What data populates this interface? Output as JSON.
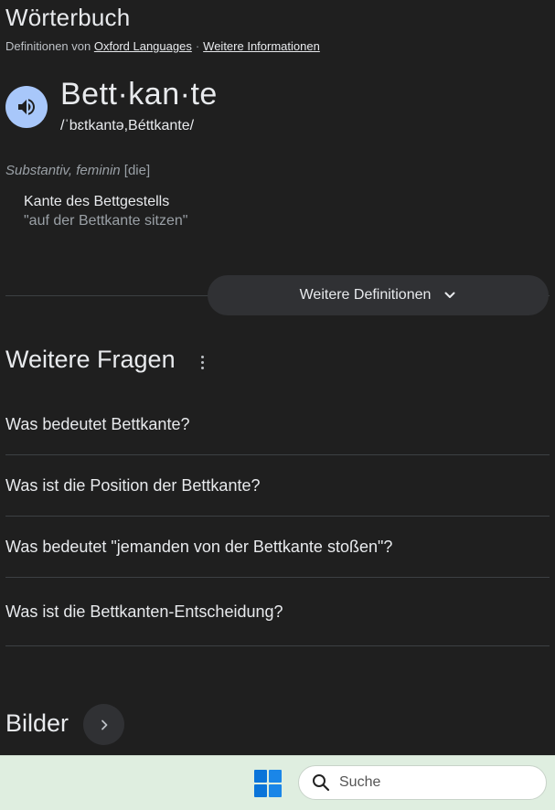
{
  "dictionary": {
    "title": "Wörterbuch",
    "source_prefix": "Definitionen von",
    "source_link": "Oxford Languages",
    "separator": "·",
    "more_info_link": "Weitere Informationen"
  },
  "entry": {
    "headword": "Bett·kan·te",
    "phonetic": "/ˈbɛtkantə,Béttkante/",
    "part_of_speech": "Substantiv, feminin",
    "article": "[die]",
    "definition": "Kante des Bettgestells",
    "example": "\"auf der Bettkante sitzen\""
  },
  "more_definitions_label": "Weitere Definitionen",
  "faq": {
    "title": "Weitere Fragen",
    "questions": [
      "Was bedeutet Bettkante?",
      "Was ist die Position der Bettkante?",
      "Was bedeutet \"jemanden von der Bettkante stoßen\"?",
      "Was ist die Bettkanten-Entscheidung?"
    ]
  },
  "images": {
    "title": "Bilder"
  },
  "taskbar": {
    "search_label": "Suche"
  },
  "colors": {
    "background": "#1f1f1f",
    "speaker_accent": "#a8c7fa",
    "pill": "#303134",
    "taskbar": "#dfeee0",
    "windows_blue": "#0a74d9"
  },
  "icons": [
    "speaker-icon",
    "chevron-down-icon",
    "more-vert-icon",
    "chevron-right-icon",
    "windows-logo-icon",
    "search-icon"
  ]
}
